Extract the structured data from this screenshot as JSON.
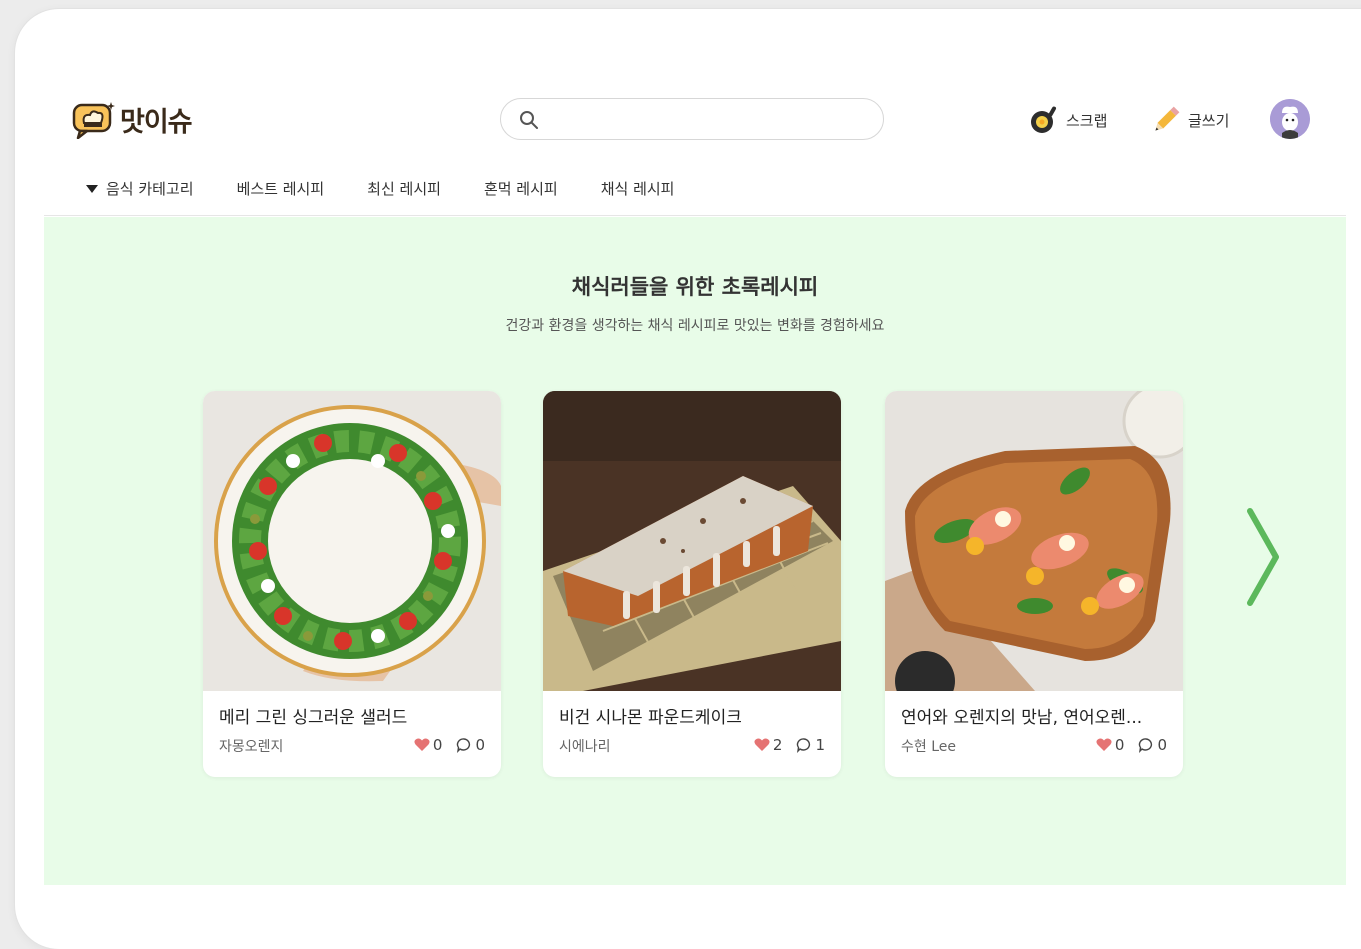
{
  "header": {
    "logo_text": "맛이슈",
    "search": {
      "value": "",
      "placeholder": ""
    },
    "scrap_label": "스크랩",
    "write_label": "글쓰기"
  },
  "nav": {
    "category_label": "음식 카테고리",
    "items": [
      "베스트 레시피",
      "최신 레시피",
      "혼먹 레시피",
      "채식 레시피"
    ]
  },
  "banner": {
    "title": "채식러들을 위한 초록레시피",
    "subtitle": "건강과 환경을 생각하는 채식 레시피로 맛있는 변화를 경험하세요",
    "cards": [
      {
        "title": "메리 그린 싱그러운 샐러드",
        "author": "자몽오렌지",
        "likes": "0",
        "comments": "0"
      },
      {
        "title": "비건 시나몬 파운드케이크",
        "author": "시에나리",
        "likes": "2",
        "comments": "1"
      },
      {
        "title": "연어와 오렌지의 맛남, 연어오렌...",
        "author": "수현 Lee",
        "likes": "0",
        "comments": "0"
      }
    ]
  },
  "colors": {
    "banner_bg": "#e8fce8",
    "accent_green": "#5cb85c",
    "heart": "#e57373"
  }
}
